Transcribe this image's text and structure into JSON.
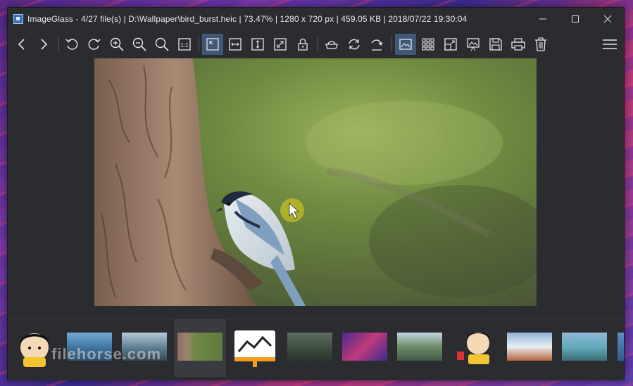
{
  "window": {
    "title": "ImageGlass - 4/27 file(s)  |  D:\\Wallpaper\\bird_burst.heic  |  73.47%  |  1280 x 720 px  |  459.05 KB  |  2018/07/22 19:30:04"
  },
  "titlebar_buttons": [
    "minimize-icon",
    "maximize-icon",
    "close-icon"
  ],
  "toolbar": {
    "items": [
      "previous-image",
      "next-image",
      "rotate-left",
      "rotate-right",
      "zoom-in",
      "zoom-out",
      "scale-to-fit",
      "actual-size",
      "auto-zoom",
      "scale-to-width",
      "scale-to-height",
      "scale-to-fill",
      "lock-zoom",
      "open-with",
      "refresh",
      "goto-image",
      "thumbnail-bar",
      "checkerboard",
      "fullscreen",
      "slideshow",
      "save",
      "print",
      "delete",
      "main-menu"
    ],
    "active": [
      "auto-zoom",
      "thumbnail-bar"
    ]
  },
  "thumbnails": {
    "count_visible": 12,
    "selected_index": 2,
    "watermark": "filehorse.com"
  },
  "colors": {
    "window_bg": "#2b2c30",
    "active_button": "#3e5876",
    "accent_blue": "#4a90d9"
  }
}
